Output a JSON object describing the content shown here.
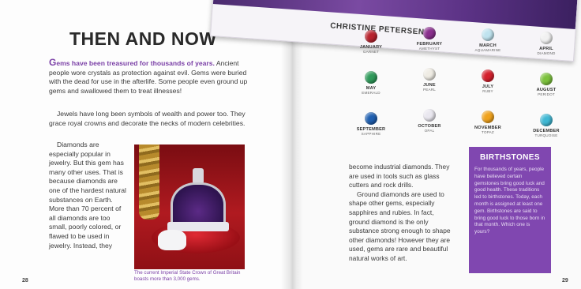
{
  "cover": {
    "author": "CHRISTINE PETERSEN"
  },
  "left_page": {
    "title": "THEN AND NOW",
    "lead_dropcap": "G",
    "lead_emph": "ems have been treasured for thousands of years.",
    "lead_rest": " Ancient people wore crystals as protection against evil. Gems were buried with the dead for use in the afterlife. Some people even ground up gems and swallowed them to treat illnesses!",
    "paragraph2": "Jewels have long been symbols of wealth and power too. They grace royal crowns and decorate the necks of modern celebrities.",
    "column_text": "Diamonds are especially popular in jewelry. But this gem has many other uses. That is because diamonds are one of the hardest natural substances on Earth. More than 70 percent of all diamonds are too small, poorly colored, or flawed to be used in jewelry. Instead, they",
    "caption": "The current Imperial State Crown of Great Britain boasts more than 3,000 gems.",
    "page_number": "28"
  },
  "right_page": {
    "gems": [
      {
        "month": "JANUARY",
        "stone": "GARNET",
        "color": "#b8232e"
      },
      {
        "month": "FEBRUARY",
        "stone": "AMETHYST",
        "color": "#8a2f8e"
      },
      {
        "month": "MARCH",
        "stone": "AQUAMARINE",
        "color": "#bfe3ef"
      },
      {
        "month": "APRIL",
        "stone": "DIAMOND",
        "color": "#f1f1f1"
      },
      {
        "month": "MAY",
        "stone": "EMERALD",
        "color": "#2f9a5a"
      },
      {
        "month": "JUNE",
        "stone": "PEARL",
        "color": "#efece4"
      },
      {
        "month": "JULY",
        "stone": "RUBY",
        "color": "#d4202c"
      },
      {
        "month": "AUGUST",
        "stone": "PERIDOT",
        "color": "#7cc23c"
      },
      {
        "month": "SEPTEMBER",
        "stone": "SAPPHIRE",
        "color": "#1f5fb0"
      },
      {
        "month": "OCTOBER",
        "stone": "OPAL",
        "color": "#e9e7ef"
      },
      {
        "month": "NOVEMBER",
        "stone": "TOPAZ",
        "color": "#f0a21c"
      },
      {
        "month": "DECEMBER",
        "stone": "TURQUOISE",
        "color": "#3fb8d4"
      }
    ],
    "text_p1": "become industrial diamonds. They are used in tools such as glass cutters and rock drills.",
    "text_p2": "Ground diamonds are used to shape other gems, especially sapphires and rubies. In fact, ground diamond is the only substance strong enough to shape other diamonds! However they are used, gems are rare and beautiful natural works of art.",
    "sidebar_title": "BIRTHSTONES",
    "sidebar_body": "For thousands of years, people have believed certain gemstones bring good luck and good health. These traditions led to birthstones. Today, each month is assigned at least one gem. Birthstones are said to bring good luck to those born in that month. Which one is yours?",
    "page_number": "29"
  },
  "colors": {
    "accent": "#7a3fa6",
    "sidebar": "#8047b0"
  }
}
